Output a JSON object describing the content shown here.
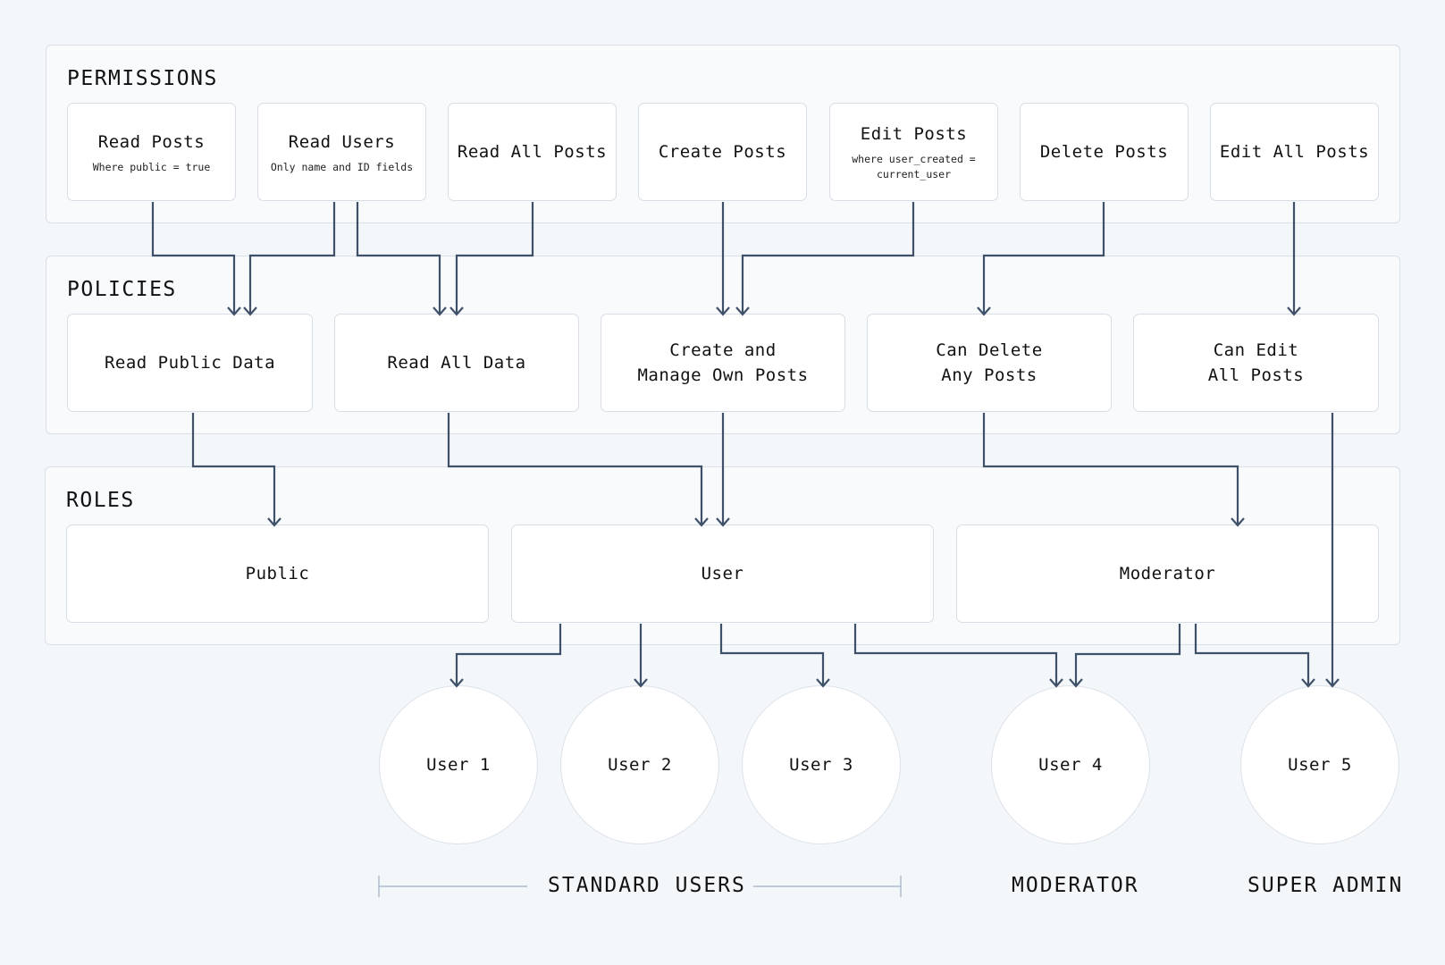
{
  "sections": {
    "permissions": {
      "title": "PERMISSIONS",
      "items": [
        {
          "label": "Read Posts",
          "sub": "Where public = true"
        },
        {
          "label": "Read Users",
          "sub": "Only name and ID fields"
        },
        {
          "label": "Read All Posts",
          "sub": ""
        },
        {
          "label": "Create Posts",
          "sub": ""
        },
        {
          "label": "Edit Posts",
          "sub": "where user_created =\ncurrent_user"
        },
        {
          "label": "Delete Posts",
          "sub": ""
        },
        {
          "label": "Edit All Posts",
          "sub": ""
        }
      ]
    },
    "policies": {
      "title": "POLICIES",
      "items": [
        {
          "label": "Read Public Data"
        },
        {
          "label": "Read All Data"
        },
        {
          "label": "Create and\nManage Own Posts"
        },
        {
          "label": "Can Delete\nAny Posts"
        },
        {
          "label": "Can Edit\nAll Posts"
        }
      ]
    },
    "roles": {
      "title": "ROLES",
      "items": [
        {
          "label": "Public"
        },
        {
          "label": "User"
        },
        {
          "label": "Moderator"
        }
      ]
    }
  },
  "users": [
    {
      "label": "User 1"
    },
    {
      "label": "User 2"
    },
    {
      "label": "User 3"
    },
    {
      "label": "User 4"
    },
    {
      "label": "User 5"
    }
  ],
  "user_groups": [
    {
      "label": "STANDARD USERS"
    },
    {
      "label": "MODERATOR"
    },
    {
      "label": "SUPER ADMIN"
    }
  ],
  "colors": {
    "connector": "#3f5168",
    "bracket": "#9fb0c4"
  },
  "connections": [
    {
      "from": "Read Posts",
      "to": "Read Public Data"
    },
    {
      "from": "Read Users",
      "to": "Read Public Data"
    },
    {
      "from": "Read Users",
      "to": "Read All Data"
    },
    {
      "from": "Read All Posts",
      "to": "Read All Data"
    },
    {
      "from": "Create Posts",
      "to": "Create and Manage Own Posts"
    },
    {
      "from": "Edit Posts",
      "to": "Create and Manage Own Posts"
    },
    {
      "from": "Delete Posts",
      "to": "Can Delete Any Posts"
    },
    {
      "from": "Edit All Posts",
      "to": "Can Edit All Posts"
    },
    {
      "from": "Read Public Data",
      "to": "Public"
    },
    {
      "from": "Read All Data",
      "to": "User"
    },
    {
      "from": "Create and Manage Own Posts",
      "to": "User"
    },
    {
      "from": "Can Delete Any Posts",
      "to": "Moderator"
    },
    {
      "from": "Can Edit All Posts",
      "to": "User 5"
    },
    {
      "from": "User",
      "to": "User 1"
    },
    {
      "from": "User",
      "to": "User 2"
    },
    {
      "from": "User",
      "to": "User 3"
    },
    {
      "from": "User",
      "to": "User 4"
    },
    {
      "from": "Moderator",
      "to": "User 4"
    },
    {
      "from": "Moderator",
      "to": "User 5"
    }
  ]
}
